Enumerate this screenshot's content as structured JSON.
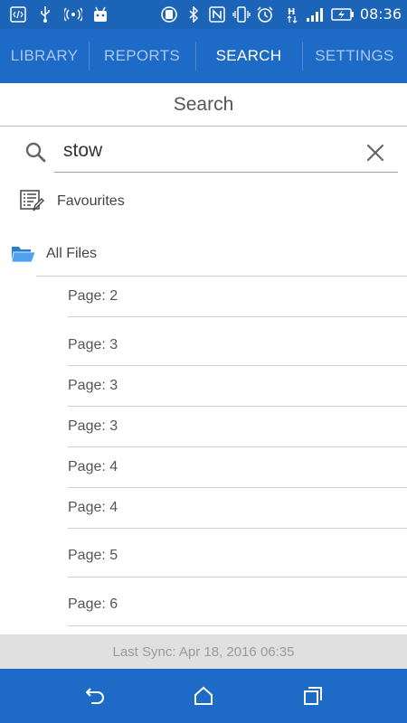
{
  "status_bar": {
    "time": "08:36",
    "icons": [
      "code-icon",
      "usb-icon",
      "hotspot-icon",
      "android-icon",
      "rotate-icon",
      "bluetooth-icon",
      "nfc-icon",
      "vibrate-icon",
      "alarm-icon",
      "data-h-icon",
      "signal-icon",
      "battery-charging-icon"
    ]
  },
  "tabs": [
    {
      "label": "LIBRARY",
      "active": false
    },
    {
      "label": "REPORTS",
      "active": false
    },
    {
      "label": "SEARCH",
      "active": true
    },
    {
      "label": "SETTINGS",
      "active": false
    }
  ],
  "search": {
    "title": "Search",
    "query": "stow"
  },
  "favourites": {
    "label": "Favourites"
  },
  "all_files": {
    "label": "All Files"
  },
  "results": [
    {
      "label": "Page: 2"
    },
    {
      "label": "Page: 3"
    },
    {
      "label": "Page: 3"
    },
    {
      "label": "Page: 3"
    },
    {
      "label": "Page: 4"
    },
    {
      "label": "Page: 4"
    },
    {
      "label": "Page: 5"
    },
    {
      "label": "Page: 6"
    }
  ],
  "footer": {
    "last_sync": "Last Sync: Apr 18, 2016 06:35"
  },
  "colors": {
    "primary": "#1e6ac7",
    "status_bar": "#1c64b7",
    "folder": "#2a7fd4"
  }
}
